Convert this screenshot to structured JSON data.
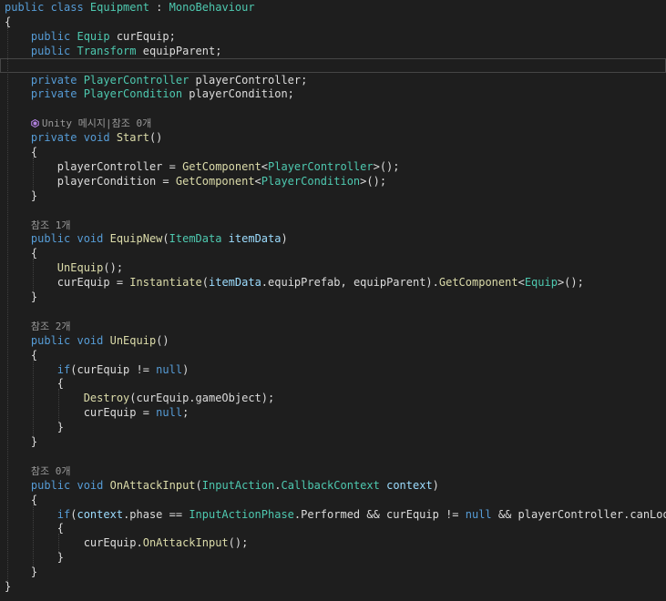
{
  "colors": {
    "background": "#1e1e1e",
    "keyword": "#569cd6",
    "type": "#4ec9b0",
    "method": "#dcdcaa",
    "param": "#9cdcfe",
    "plain": "#dcdcdc",
    "lens": "#999999",
    "unity_icon": "#b281e0"
  },
  "lines": [
    {
      "tokens": [
        [
          "public class ",
          "keyword"
        ],
        [
          "Equipment",
          "type"
        ],
        [
          " : ",
          "plain"
        ],
        [
          "MonoBehaviour",
          "type"
        ]
      ]
    },
    {
      "tokens": [
        [
          "{",
          "plain"
        ]
      ]
    },
    {
      "tokens": [
        [
          "    ",
          "plain"
        ],
        [
          "public ",
          "keyword"
        ],
        [
          "Equip",
          "type"
        ],
        [
          " curEquip;",
          "plain"
        ]
      ]
    },
    {
      "tokens": [
        [
          "    ",
          "plain"
        ],
        [
          "public ",
          "keyword"
        ],
        [
          "Transform",
          "type"
        ],
        [
          " equipParent;",
          "plain"
        ]
      ]
    },
    {
      "tokens": [],
      "current": true
    },
    {
      "tokens": [
        [
          "    ",
          "plain"
        ],
        [
          "private ",
          "keyword"
        ],
        [
          "PlayerController",
          "type"
        ],
        [
          " playerController;",
          "plain"
        ]
      ]
    },
    {
      "tokens": [
        [
          "    ",
          "plain"
        ],
        [
          "private ",
          "keyword"
        ],
        [
          "PlayerCondition",
          "type"
        ],
        [
          " playerCondition;",
          "plain"
        ]
      ]
    },
    {
      "tokens": []
    },
    {
      "tokens": [
        [
          "    ",
          "plain"
        ],
        [
          "Unity 메시지|참조 0개",
          "lens"
        ]
      ],
      "unity_icon": true
    },
    {
      "tokens": [
        [
          "    ",
          "plain"
        ],
        [
          "private void ",
          "keyword"
        ],
        [
          "Start",
          "method"
        ],
        [
          "()",
          "plain"
        ]
      ]
    },
    {
      "tokens": [
        [
          "    {",
          "plain"
        ]
      ]
    },
    {
      "tokens": [
        [
          "        playerController = ",
          "plain"
        ],
        [
          "GetComponent",
          "method"
        ],
        [
          "<",
          "plain"
        ],
        [
          "PlayerController",
          "type"
        ],
        [
          ">();",
          "plain"
        ]
      ]
    },
    {
      "tokens": [
        [
          "        playerCondition = ",
          "plain"
        ],
        [
          "GetComponent",
          "method"
        ],
        [
          "<",
          "plain"
        ],
        [
          "PlayerCondition",
          "type"
        ],
        [
          ">();",
          "plain"
        ]
      ]
    },
    {
      "tokens": [
        [
          "    }",
          "plain"
        ]
      ]
    },
    {
      "tokens": []
    },
    {
      "tokens": [
        [
          "    ",
          "plain"
        ],
        [
          "참조 1개",
          "lens"
        ]
      ]
    },
    {
      "tokens": [
        [
          "    ",
          "plain"
        ],
        [
          "public void ",
          "keyword"
        ],
        [
          "EquipNew",
          "method"
        ],
        [
          "(",
          "plain"
        ],
        [
          "ItemData",
          "type"
        ],
        [
          " ",
          "plain"
        ],
        [
          "itemData",
          "param"
        ],
        [
          ")",
          "plain"
        ]
      ]
    },
    {
      "tokens": [
        [
          "    {",
          "plain"
        ]
      ]
    },
    {
      "tokens": [
        [
          "        ",
          "plain"
        ],
        [
          "UnEquip",
          "method"
        ],
        [
          "();",
          "plain"
        ]
      ]
    },
    {
      "tokens": [
        [
          "        curEquip = ",
          "plain"
        ],
        [
          "Instantiate",
          "method"
        ],
        [
          "(",
          "plain"
        ],
        [
          "itemData",
          "param"
        ],
        [
          ".equipPrefab, equipParent).",
          "plain"
        ],
        [
          "GetComponent",
          "method"
        ],
        [
          "<",
          "plain"
        ],
        [
          "Equip",
          "type"
        ],
        [
          ">();",
          "plain"
        ]
      ]
    },
    {
      "tokens": [
        [
          "    }",
          "plain"
        ]
      ]
    },
    {
      "tokens": []
    },
    {
      "tokens": [
        [
          "    ",
          "plain"
        ],
        [
          "참조 2개",
          "lens"
        ]
      ]
    },
    {
      "tokens": [
        [
          "    ",
          "plain"
        ],
        [
          "public void ",
          "keyword"
        ],
        [
          "UnEquip",
          "method"
        ],
        [
          "()",
          "plain"
        ]
      ]
    },
    {
      "tokens": [
        [
          "    {",
          "plain"
        ]
      ]
    },
    {
      "tokens": [
        [
          "        ",
          "plain"
        ],
        [
          "if",
          "keyword"
        ],
        [
          "(curEquip != ",
          "plain"
        ],
        [
          "null",
          "keyword"
        ],
        [
          ")",
          "plain"
        ]
      ]
    },
    {
      "tokens": [
        [
          "        {",
          "plain"
        ]
      ]
    },
    {
      "tokens": [
        [
          "            ",
          "plain"
        ],
        [
          "Destroy",
          "method"
        ],
        [
          "(curEquip.gameObject);",
          "plain"
        ]
      ]
    },
    {
      "tokens": [
        [
          "            curEquip = ",
          "plain"
        ],
        [
          "null",
          "keyword"
        ],
        [
          ";",
          "plain"
        ]
      ]
    },
    {
      "tokens": [
        [
          "        }",
          "plain"
        ]
      ]
    },
    {
      "tokens": [
        [
          "    }",
          "plain"
        ]
      ]
    },
    {
      "tokens": []
    },
    {
      "tokens": [
        [
          "    ",
          "plain"
        ],
        [
          "참조 0개",
          "lens"
        ]
      ]
    },
    {
      "tokens": [
        [
          "    ",
          "plain"
        ],
        [
          "public void ",
          "keyword"
        ],
        [
          "OnAttackInput",
          "method"
        ],
        [
          "(",
          "plain"
        ],
        [
          "InputAction",
          "type"
        ],
        [
          ".",
          "plain"
        ],
        [
          "CallbackContext",
          "type"
        ],
        [
          " ",
          "plain"
        ],
        [
          "context",
          "param"
        ],
        [
          ")",
          "plain"
        ]
      ]
    },
    {
      "tokens": [
        [
          "    {",
          "plain"
        ]
      ]
    },
    {
      "tokens": [
        [
          "        ",
          "plain"
        ],
        [
          "if",
          "keyword"
        ],
        [
          "(",
          "plain"
        ],
        [
          "context",
          "param"
        ],
        [
          ".phase == ",
          "plain"
        ],
        [
          "InputActionPhase",
          "type"
        ],
        [
          ".Performed && curEquip != ",
          "plain"
        ],
        [
          "null",
          "keyword"
        ],
        [
          " && playerController.canLook)",
          "plain"
        ]
      ]
    },
    {
      "tokens": [
        [
          "        {",
          "plain"
        ]
      ]
    },
    {
      "tokens": [
        [
          "            curEquip.",
          "plain"
        ],
        [
          "OnAttackInput",
          "method"
        ],
        [
          "();",
          "plain"
        ]
      ]
    },
    {
      "tokens": [
        [
          "        }",
          "plain"
        ]
      ]
    },
    {
      "tokens": [
        [
          "    }",
          "plain"
        ]
      ]
    },
    {
      "tokens": [
        [
          "}",
          "plain"
        ]
      ]
    }
  ]
}
